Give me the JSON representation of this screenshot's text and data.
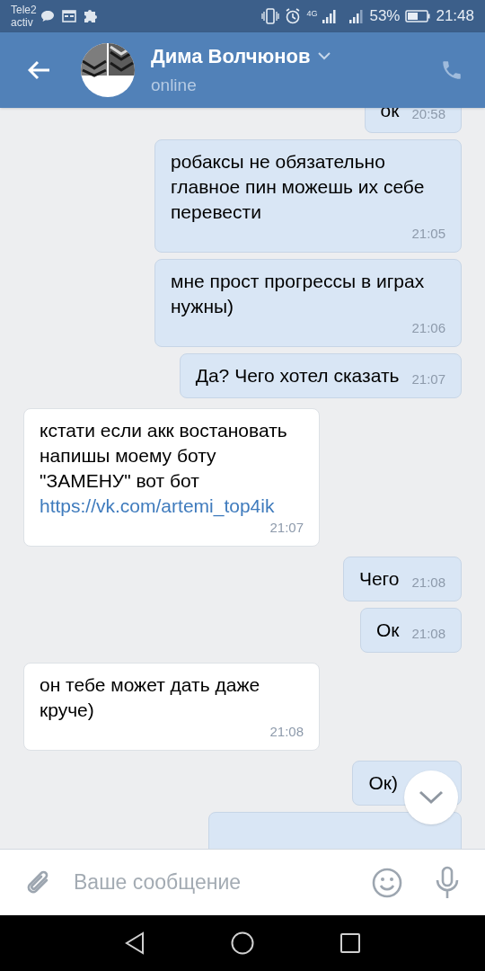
{
  "status_bar": {
    "carrier": "Tele2",
    "carrier_sub": "activ",
    "battery": "53%",
    "time": "21:48",
    "network": "4G"
  },
  "header": {
    "name": "Дима Волчюнов",
    "status": "online"
  },
  "messages": [
    {
      "kind": "outgoing",
      "text": "ок",
      "time": "20:58"
    },
    {
      "kind": "outgoing",
      "text": "робаксы не обязательно главное пин можешь их себе перевести",
      "time": "21:05"
    },
    {
      "kind": "outgoing",
      "text": "мне прост прогрессы в играх нужны)",
      "time": "21:06"
    },
    {
      "kind": "outgoing",
      "text": "Да? Чего хотел сказать",
      "time": "21:07"
    },
    {
      "kind": "incoming",
      "text": "кстати если акк востановать напишы моему боту \"ЗАМЕНУ\" вот бот",
      "link": "https://vk.com/artemi_top4ik",
      "time": "21:07"
    },
    {
      "kind": "outgoing",
      "text": "Чего",
      "time": "21:08"
    },
    {
      "kind": "outgoing",
      "text": "Ок",
      "time": "21:08"
    },
    {
      "kind": "incoming",
      "text": "он тебе может дать даже круче)",
      "time": "21:08"
    },
    {
      "kind": "outgoing",
      "text": "Ок)"
    },
    {
      "kind": "outgoing"
    }
  ],
  "composer": {
    "placeholder": "Ваше сообщение"
  }
}
